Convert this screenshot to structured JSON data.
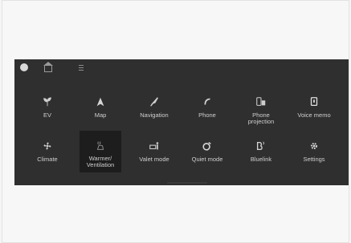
{
  "screen": {
    "topbar": {
      "buttons": [
        {
          "name": "profile-circle"
        },
        {
          "name": "home-icon"
        },
        {
          "name": "menu-icon"
        }
      ]
    },
    "tiles": [
      {
        "label": "EV",
        "icon": "ev-leaf-icon"
      },
      {
        "label": "Map",
        "icon": "map-arrow-icon"
      },
      {
        "label": "Navigation",
        "icon": "navigation-icon"
      },
      {
        "label": "Phone",
        "icon": "phone-icon"
      },
      {
        "label": "Phone\nprojection",
        "icon": "phone-projection-icon"
      },
      {
        "label": "Voice memo",
        "icon": "voice-memo-icon"
      },
      {
        "label": "Climate",
        "icon": "fan-icon"
      },
      {
        "label": "Warmer/\nVentilation",
        "icon": "seat-heat-icon",
        "selected": true
      },
      {
        "label": "Valet mode",
        "icon": "valet-icon"
      },
      {
        "label": "Quiet mode",
        "icon": "quiet-mode-icon"
      },
      {
        "label": "Bluelink",
        "icon": "bluelink-icon"
      },
      {
        "label": "Settings",
        "icon": "gear-icon"
      }
    ]
  }
}
